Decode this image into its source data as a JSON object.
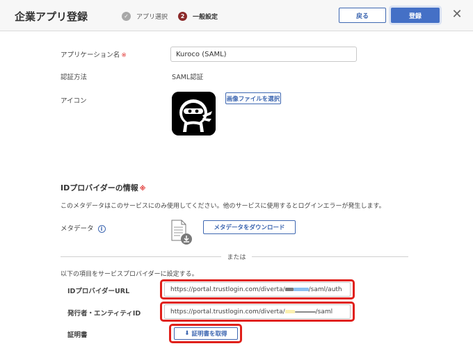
{
  "header": {
    "title": "企業アプリ登録",
    "step1_label": "アプリ選択",
    "step2_number": "2",
    "step2_label": "一般設定",
    "back_label": "戻る",
    "register_label": "登録",
    "close_glyph": "✕"
  },
  "form": {
    "app_name_label": "アプリケーション名",
    "required_mark": "※",
    "app_name_value": "Kuroco (SAML)",
    "auth_label": "認証方法",
    "auth_value": "SAML認証",
    "icon_label": "アイコン",
    "select_image_label": "画像ファイルを選択"
  },
  "idp": {
    "section_title": "IDプロバイダーの情報",
    "required_mark": "※",
    "note": "このメタデータはこのサービスにのみ使用してください。他のサービスに使用するとログインエラーが発生します。",
    "metadata_label": "メタデータ",
    "info_glyph": "i",
    "download_metadata_label": "メタデータをダウンロード",
    "or_label": "または",
    "instruction": "以下の項目をサービスプロバイダーに設定する。",
    "idp_url_label": "IDプロバイダーURL",
    "idp_url_prefix": "https://portal.trustlogin.com/diverta/",
    "idp_url_suffix": "/saml/auth",
    "issuer_label": "発行者・エンティティID",
    "issuer_prefix": "https://portal.trustlogin.com/diverta/",
    "issuer_suffix": "/saml",
    "cert_label": "証明書",
    "get_cert_label": "証明書を取得"
  },
  "colors": {
    "accent": "#3e67b1",
    "primary_button": "#4470c6",
    "required": "#e0312e",
    "highlight": "#e0201a"
  }
}
